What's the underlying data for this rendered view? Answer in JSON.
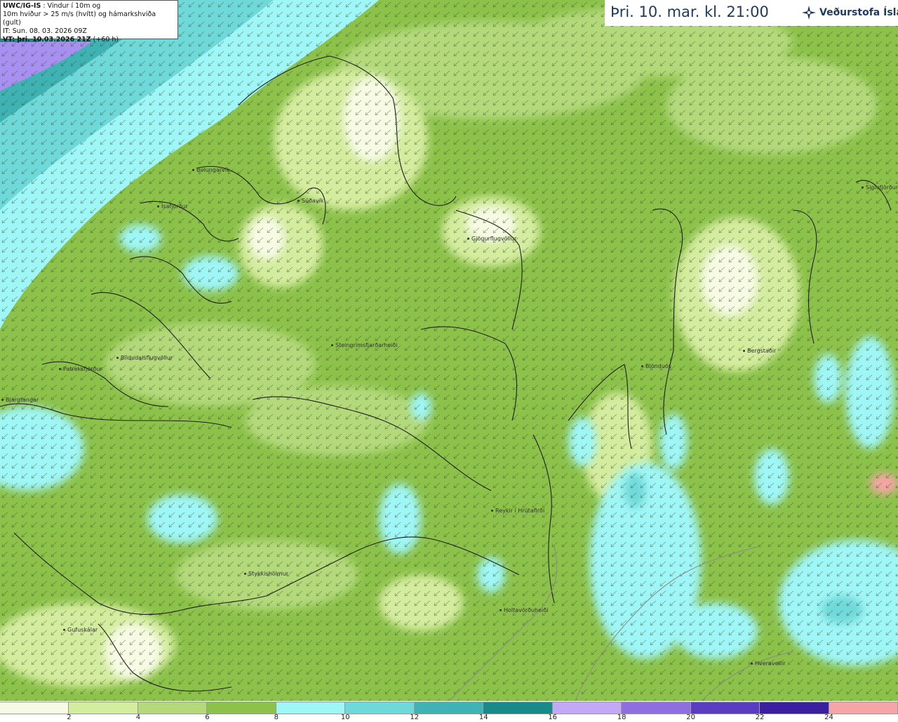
{
  "info": {
    "model": "UWC/IG-IS",
    "desc1": ": Vindur í 10m og",
    "desc2": "10m hviður > 25 m/s (hvítt) og hámarkshviða (gult)",
    "it": "IT: Sun. 08. 03. 2026 09Z",
    "vt_label": "VT: þri. 10.03.2026 21Z",
    "vt_offset": "(+60 h)"
  },
  "header": {
    "time": "Þri. 10. mar. kl. 21:00",
    "brand": "Veðurstofa Íslands",
    "logo_icon": "snowflake-star-icon"
  },
  "places": [
    {
      "name": "Bolungarvík"
    },
    {
      "name": "Ísafjörður"
    },
    {
      "name": "Súðavík"
    },
    {
      "name": "Gjögurflugvöllur"
    },
    {
      "name": "Patreksfjörður"
    },
    {
      "name": "Bíldudalsflugvöllur"
    },
    {
      "name": "Bjargtangar"
    },
    {
      "name": "Steingrímsfjarðarheiði"
    },
    {
      "name": "Blönduós"
    },
    {
      "name": "Bergstaðir"
    },
    {
      "name": "Siglufjörður"
    },
    {
      "name": "Reykir í Hrútafirði"
    },
    {
      "name": "Stykkishólmur"
    },
    {
      "name": "Holtavörðuheiði"
    },
    {
      "name": "Gufuskálar"
    },
    {
      "name": "Hveravellir"
    }
  ],
  "legend": {
    "ticks": [
      "2",
      "4",
      "6",
      "8",
      "10",
      "12",
      "14",
      "16",
      "18",
      "20",
      "22",
      "24"
    ],
    "colors": [
      "#f7fbe4",
      "#d4ec9e",
      "#b3d97a",
      "#8cc24a",
      "#9ff6f6",
      "#6fd9d9",
      "#3fb3b3",
      "#188a8a",
      "#c2a8f5",
      "#8f6fe0",
      "#5a3cc0",
      "#3a1f9e",
      "#f5a5a5"
    ]
  },
  "map_colors": {
    "calm": "#f7fbe4",
    "light": "#d4ec9e",
    "moderate": "#b3d97a",
    "fresh": "#8cc24a",
    "strong": "#9ff6f6",
    "teal": "#3fb3b3",
    "deep_teal": "#188a8a",
    "violet": "#a890f0"
  }
}
